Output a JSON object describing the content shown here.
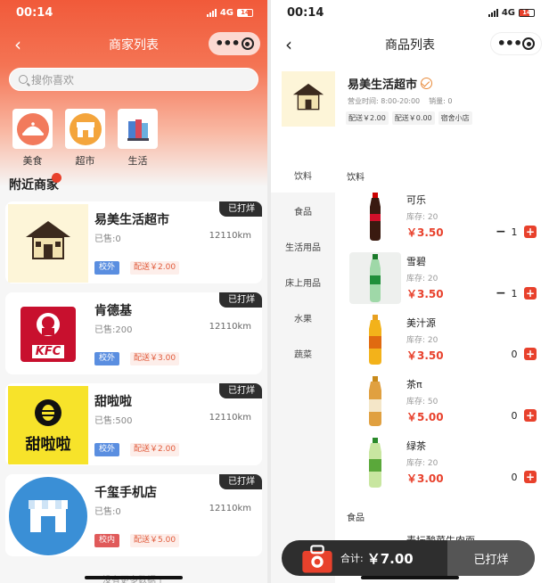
{
  "left": {
    "status": {
      "time": "00:14",
      "network": "4G",
      "battery": "14"
    },
    "nav": {
      "title": "商家列表"
    },
    "search": {
      "placeholder": "搜你喜欢"
    },
    "categories": [
      {
        "label": "美食",
        "icon": "food-cover-icon"
      },
      {
        "label": "超市",
        "icon": "store-icon"
      },
      {
        "label": "生活",
        "icon": "books-icon"
      }
    ],
    "nearby_title": "附近商家",
    "shops": [
      {
        "name": "易美生活超市",
        "sold": "已售:0",
        "distance": "12110km",
        "location": "校外",
        "fee": "配送￥2.00",
        "status": "已打烊",
        "logo_caption": "易美生活超市"
      },
      {
        "name": "肯德基",
        "sold": "已售:200",
        "distance": "12110km",
        "location": "校外",
        "fee": "配送￥3.00",
        "status": "已打烊",
        "logo_text": "KFC"
      },
      {
        "name": "甜啦啦",
        "sold": "已售:500",
        "distance": "12110km",
        "location": "校外",
        "fee": "配送￥2.00",
        "status": "已打烊",
        "logo_text": "甜啦啦"
      },
      {
        "name": "千玺手机店",
        "sold": "已售:0",
        "distance": "12110km",
        "location": "校内",
        "fee": "配送￥5.00",
        "status": "已打烊"
      }
    ],
    "footer": "没有更多数据了"
  },
  "right": {
    "status": {
      "time": "00:14",
      "network": "4G",
      "battery": "14"
    },
    "nav": {
      "title": "商品列表"
    },
    "shop": {
      "name": "易美生活超市",
      "hours": "营业时间: 8:00-20:00",
      "sales": "销量: 0",
      "tags": [
        "配送￥2.00",
        "配送￥0.00",
        "宿舍小店"
      ]
    },
    "sidebar": [
      "饮料",
      "食品",
      "生活用品",
      "床上用品",
      "水果",
      "蔬菜"
    ],
    "section_drinks": "饮料",
    "section_food": "食品",
    "products": [
      {
        "name": "可乐",
        "stock": "库存: 20",
        "price": "￥3.50",
        "qty": "1",
        "minus": "−",
        "plus": "+"
      },
      {
        "name": "雪碧",
        "stock": "库存: 20",
        "price": "￥3.50",
        "qty": "1",
        "minus": "−",
        "plus": "+"
      },
      {
        "name": "美汁源",
        "stock": "库存: 20",
        "price": "￥3.50",
        "qty": "0",
        "plus": "+"
      },
      {
        "name": "茶π",
        "stock": "库存: 50",
        "price": "￥5.00",
        "qty": "0",
        "plus": "+"
      },
      {
        "name": "绿茶",
        "stock": "库存: 20",
        "price": "￥3.00",
        "qty": "0",
        "plus": "+"
      }
    ],
    "partial_product_name": "麦坛酸菜牛肉面",
    "cart": {
      "total_label": "合计:",
      "total": "￥7.00",
      "button": "已打烊"
    }
  },
  "colors": {
    "accent": "#e8412c",
    "header": "#f15a3a",
    "tag_blue": "#5a8ee0",
    "dark": "#2e2e2e"
  }
}
